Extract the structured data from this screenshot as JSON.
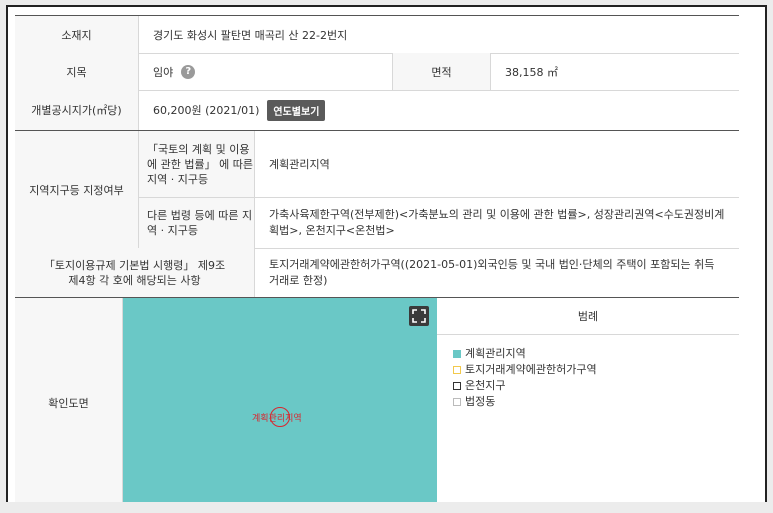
{
  "rows": {
    "location": {
      "label": "소재지",
      "value": "경기도 화성시 팔탄면 매곡리 산 22-2번지"
    },
    "land_category": {
      "label": "지목",
      "value": "임야",
      "help": "?"
    },
    "area": {
      "label": "면적",
      "value": "38,158 ㎡"
    },
    "land_price": {
      "label": "개별공시지가(㎡당)",
      "value": "60,200원 (2021/01)",
      "button": "연도별보기"
    },
    "zoning": {
      "label": "지역지구등 지정여부",
      "national_law": {
        "label": "「국토의 계획 및 이용에 관한 법률」 에 따른 지역 · 지구등",
        "value": "계획관리지역"
      },
      "other_law": {
        "label": "다른 법령 등에 따른 지역 · 지구등",
        "value": "가축사육제한구역(전부제한)<가축분뇨의 관리 및 이용에 관한 법률>, 성장관리권역<수도권정비계획법>, 온천지구<온천법>"
      }
    },
    "regulation": {
      "label": "「토지이용규제 기본법 시행령」 제9조 제4항 각 호에 해당되는 사항",
      "value": "토지거래계약에관한허가구역((2021-05-01)외국인등 및 국내 법인·단체의 주택이 포함되는 취득 거래로 한정)"
    },
    "map": {
      "label": "확인도면",
      "map_label": "계획관리지역",
      "legend_title": "범례",
      "legend": [
        {
          "label": "계획관리지역",
          "color": "#6ac8c6",
          "border": "#6ac8c6"
        },
        {
          "label": "토지거래계약에관한허가구역",
          "color": "#ffffff",
          "border": "#f2c94c"
        },
        {
          "label": "온천지구",
          "color": "#ffffff",
          "border": "#333333"
        },
        {
          "label": "법정동",
          "color": "#ffffff",
          "border": "#bbbbbb"
        }
      ]
    }
  }
}
